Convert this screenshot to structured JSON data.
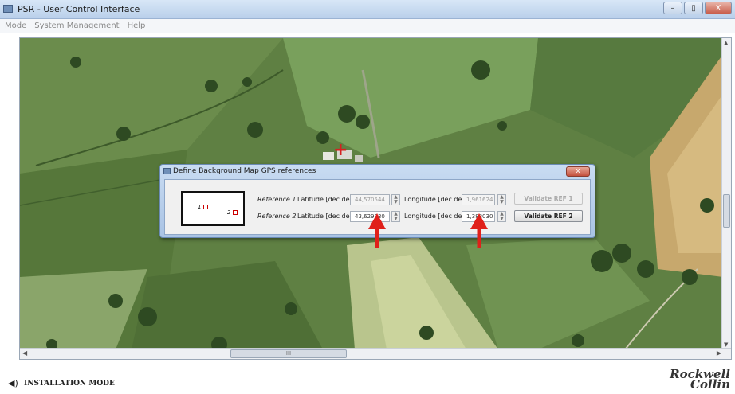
{
  "window": {
    "title": "PSR - User Control Interface",
    "controls": {
      "minimize": "–",
      "maximize": "▯",
      "close": "X"
    }
  },
  "menu": [
    "Mode",
    "System Management",
    "Help"
  ],
  "map": {
    "background": "satellite aerial view",
    "marker": "+"
  },
  "scrollbar": {
    "up": "▲",
    "down": "▼",
    "left": "◀",
    "right": "▶",
    "grip": "III"
  },
  "dialog": {
    "title": "Define Background Map GPS references",
    "close_label": "x",
    "preview": {
      "ref1_label": "1",
      "ref2_label": "2"
    },
    "ref1": {
      "label": "Reference 1",
      "lat_label": "Latitude [dec deg]",
      "lat_value": "44,570544",
      "lon_label": "Longitude [dec deg]",
      "lon_value": "1,961624",
      "button": "Validate REF 1",
      "enabled": false
    },
    "ref2": {
      "label": "Reference 2",
      "lat_label": "Latitude [dec deg]",
      "lat_value": "43,629230",
      "lon_label": "Longitude [dec deg]",
      "lon_value": "1,388030",
      "button": "Validate REF 2",
      "enabled": true
    }
  },
  "status": {
    "mode": "INSTALLATION MODE",
    "speaker_icon": "speaker-icon",
    "brand_line1": "Rockwell",
    "brand_line2": "Collin"
  },
  "colors": {
    "accent_arrow": "#e0201a",
    "marker": "#d62020"
  }
}
